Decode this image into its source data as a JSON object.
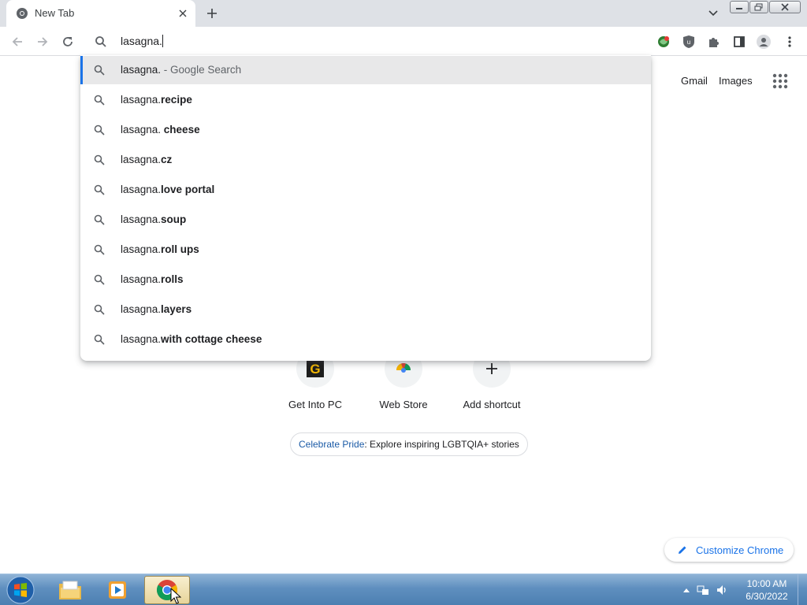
{
  "browser": {
    "tab": {
      "title": "New Tab"
    },
    "omnibox": {
      "value": "lasagna."
    }
  },
  "suggestions": [
    {
      "prefix": "lasagna.",
      "bold": "",
      "hint": " - Google Search",
      "selected": true
    },
    {
      "prefix": "lasagna.",
      "bold": "recipe",
      "hint": ""
    },
    {
      "prefix": "lasagna. ",
      "bold": "cheese",
      "hint": ""
    },
    {
      "prefix": "lasagna.",
      "bold": "cz",
      "hint": ""
    },
    {
      "prefix": "lasagna.",
      "bold": "love portal",
      "hint": ""
    },
    {
      "prefix": "lasagna.",
      "bold": "soup",
      "hint": ""
    },
    {
      "prefix": "lasagna.",
      "bold": "roll ups",
      "hint": ""
    },
    {
      "prefix": "lasagna.",
      "bold": "rolls",
      "hint": ""
    },
    {
      "prefix": "lasagna.",
      "bold": "layers",
      "hint": ""
    },
    {
      "prefix": "lasagna.",
      "bold": "with cottage cheese",
      "hint": ""
    }
  ],
  "ntp": {
    "gmail": "Gmail",
    "images": "Images",
    "shortcuts": [
      {
        "label": "Get Into PC",
        "icon": "get-into-pc-icon"
      },
      {
        "label": "Web Store",
        "icon": "web-store-icon"
      },
      {
        "label": "Add shortcut",
        "icon": "plus-icon"
      }
    ],
    "pride_link": "Celebrate Pride",
    "pride_text": ": Explore inspiring LGBTQIA+ stories",
    "customize": "Customize Chrome"
  },
  "taskbar": {
    "time": "10:00 AM",
    "date": "6/30/2022"
  },
  "colors": {
    "accent": "#1a73e8",
    "tabstrip": "#dee1e6",
    "selected_row": "#e8e8e9"
  }
}
